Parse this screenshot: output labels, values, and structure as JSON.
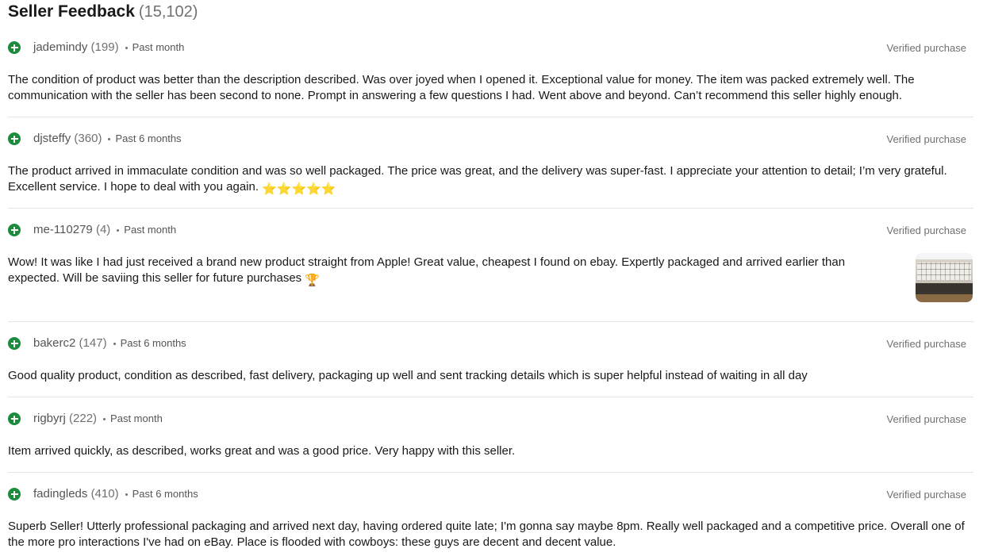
{
  "header": {
    "title": "Seller Feedback",
    "count": "(15,102)"
  },
  "feedback": [
    {
      "user": "jademindy",
      "score": "(199)",
      "period": "Past month",
      "verified": "Verified purchase",
      "comment": "The condition of product was better than the description described. Was over joyed when I opened it. Exceptional value for money. The item was packed extremely well. The communication with the seller has been second to none. Prompt in answering a few questions I had. Went above and beyond. Can’t recommend this seller highly enough."
    },
    {
      "user": "djsteffy",
      "score": "(360)",
      "period": "Past 6 months",
      "verified": "Verified purchase",
      "comment": "The product arrived in immaculate condition and was so well packaged. The price was great, and the delivery was super-fast. I appreciate your attention to detail; I’m very grateful. Excellent service. I hope to deal with you again.",
      "emoji": "⭐⭐⭐⭐⭐"
    },
    {
      "user": "me-110279",
      "score": "(4)",
      "period": "Past month",
      "verified": "Verified purchase",
      "comment": "Wow! It was like I had just received a brand new product straight from Apple! Great value, cheapest I found on ebay. Expertly packaged and arrived earlier than expected. Will be saviing this seller for future purchases",
      "emoji": "🏆"
    },
    {
      "user": "bakerc2",
      "score": "(147)",
      "period": "Past 6 months",
      "verified": "Verified purchase",
      "comment": "Good quality product, condition as described, fast delivery, packaging up well and sent tracking details which is super helpful instead of waiting in all day"
    },
    {
      "user": "rigbyrj",
      "score": "(222)",
      "period": "Past month",
      "verified": "Verified purchase",
      "comment": "Item arrived quickly, as described, works great and was a good price. Very happy with this seller."
    },
    {
      "user": "fadingleds",
      "score": "(410)",
      "period": "Past 6 months",
      "verified": "Verified purchase",
      "comment": "Superb Seller! Utterly professional packaging and arrived next day, having ordered quite late; I'm gonna say maybe 8pm. Really well packaged and a competitive price. Overall one of the more pro interactions I've had on eBay. Place is flooded with cowboys: these guys are decent and decent value."
    }
  ],
  "icons": {
    "positive": "positive-feedback-plus-icon",
    "photo": "feedback-photo-thumbnail"
  },
  "colors": {
    "positive": "#1c8b3c",
    "muted_text": "#707070",
    "divider": "#e5e5e5"
  }
}
